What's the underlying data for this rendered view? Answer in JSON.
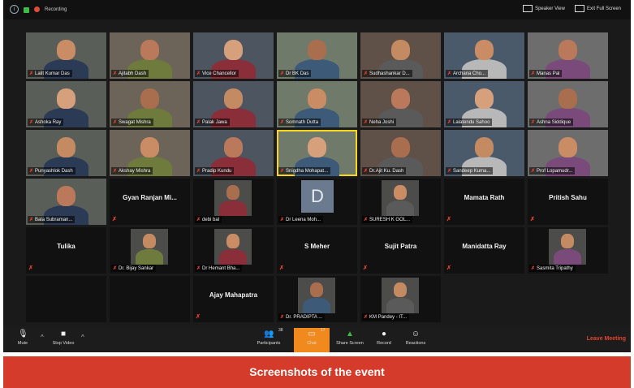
{
  "topbar": {
    "recording_label": "Recording",
    "speaker_view_label": "Speaker View",
    "exit_fullscreen_label": "Exit Full Screen"
  },
  "participants": [
    {
      "name": "Lalit Kumar Das",
      "type": "video"
    },
    {
      "name": "Ajitabh Dash",
      "type": "video"
    },
    {
      "name": "Vice Chancellor",
      "type": "video"
    },
    {
      "name": "Dr BK Das",
      "type": "video"
    },
    {
      "name": "Sudhashankar D...",
      "type": "video"
    },
    {
      "name": "Archana Cho...",
      "type": "video"
    },
    {
      "name": "Manas Pal",
      "type": "video"
    },
    {
      "name": "Ashoka Ray",
      "type": "video"
    },
    {
      "name": "Swagat Mishra",
      "type": "video"
    },
    {
      "name": "Palak Jawa",
      "type": "video"
    },
    {
      "name": "Somnath Dutta",
      "type": "video"
    },
    {
      "name": "Neha Joshi",
      "type": "video"
    },
    {
      "name": "Lalatendu Sahoo",
      "type": "video"
    },
    {
      "name": "Ashna Siddique",
      "type": "video"
    },
    {
      "name": "Punyashlok Dash",
      "type": "video"
    },
    {
      "name": "Akshay Mishra",
      "type": "video"
    },
    {
      "name": "Pradip Kundu",
      "type": "video"
    },
    {
      "name": "Snigdha Mohapat...",
      "type": "video"
    },
    {
      "name": "Dr.Ajit Ku. Dash",
      "type": "video"
    },
    {
      "name": "Sandeep Kuma...",
      "type": "video"
    },
    {
      "name": "Prof Lopamudr...",
      "type": "video"
    },
    {
      "name": "Bala Subraman...",
      "type": "video"
    },
    {
      "name": "Gyan Ranjan Mi...",
      "type": "name"
    },
    {
      "name": "debi bal",
      "type": "small"
    },
    {
      "name": "Dr Leena Moh...",
      "type": "avatar",
      "initial": "D"
    },
    {
      "name": "SURESH K GOL...",
      "type": "small"
    },
    {
      "name": "Mamata Rath",
      "type": "name"
    },
    {
      "name": "Pritish Sahu",
      "type": "name"
    },
    {
      "name": "Tulika",
      "type": "name"
    },
    {
      "name": "Dr. Bijay Sankar",
      "type": "small"
    },
    {
      "name": "Dr Hemant Bha...",
      "type": "small"
    },
    {
      "name": "S Meher",
      "type": "name"
    },
    {
      "name": "Sujit Patra",
      "type": "name"
    },
    {
      "name": "Manidatta Ray",
      "type": "name"
    },
    {
      "name": "Sasmita Tripathy",
      "type": "small"
    },
    {
      "name": "",
      "type": "empty"
    },
    {
      "name": "",
      "type": "empty"
    },
    {
      "name": "Ajay Mahapatra",
      "type": "name"
    },
    {
      "name": "Dr. PRADIPTA ...",
      "type": "small"
    },
    {
      "name": "KM Pandey - IT...",
      "type": "small"
    }
  ],
  "toolbar": {
    "mute_label": "Mute",
    "stop_video_label": "Stop Video",
    "participants_label": "Participants",
    "participants_count": "38",
    "chat_label": "Chat",
    "chat_count": "17",
    "share_screen_label": "Share Screen",
    "record_label": "Record",
    "reactions_label": "Reactions",
    "leave_label": "Leave Meeting"
  },
  "caption": "Screenshots of the event",
  "colors": {
    "banner": "#d43b2a",
    "chat_active": "#f08a1e",
    "mic_muted": "#e6432c",
    "active_speaker": "#f7d61d"
  }
}
